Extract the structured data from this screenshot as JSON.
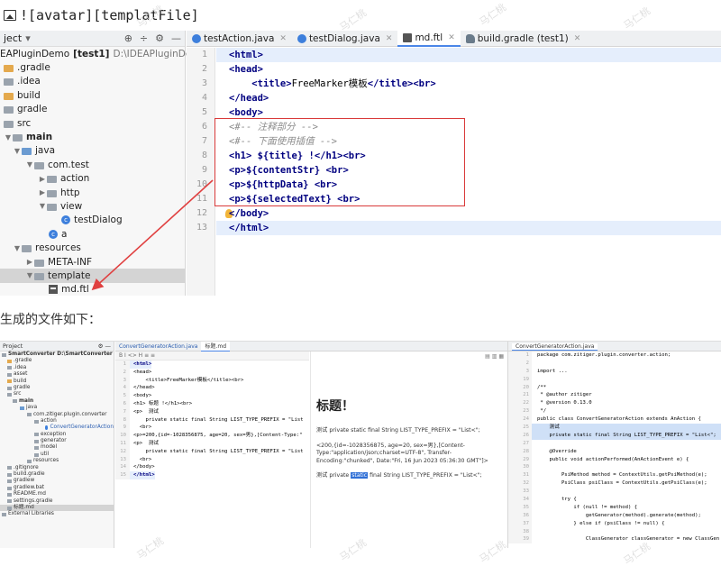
{
  "markdown_line": "![avatar][templatFile]",
  "caption": "生成的文件如下：",
  "watermark": "马仁桃",
  "ide1": {
    "project_header": {
      "title": "ject",
      "caret": "▾"
    },
    "tree": [
      {
        "label": "EAPluginDemo",
        "bold": "[test1]",
        "path": "D:\\IDEAPluginDemo"
      },
      {
        "label": ".gradle"
      },
      {
        "label": ".idea"
      },
      {
        "label": "build"
      },
      {
        "label": "gradle"
      },
      {
        "label": "src"
      },
      {
        "label": "main"
      },
      {
        "label": "java"
      },
      {
        "label": "com.test"
      },
      {
        "label": "action"
      },
      {
        "label": "http"
      },
      {
        "label": "view"
      },
      {
        "label": "testDialog"
      },
      {
        "label": "a"
      },
      {
        "label": "resources"
      },
      {
        "label": "META-INF"
      },
      {
        "label": "template"
      },
      {
        "label": "md.ftl"
      }
    ],
    "tabs": [
      {
        "label": "testAction.java"
      },
      {
        "label": "testDialog.java"
      },
      {
        "label": "md.ftl"
      },
      {
        "label": "build.gradle (test1)"
      }
    ],
    "line_numbers": [
      "1",
      "2",
      "3",
      "4",
      "5",
      "6",
      "7",
      "8",
      "9",
      "10",
      "11",
      "12",
      "13"
    ],
    "code": {
      "l1": "<html>",
      "l2": "<head>",
      "l3a": "<title>",
      "l3b": "FreeMarker模板",
      "l3c": "</title><br>",
      "l4": "</head>",
      "l5": "<body>",
      "l6": "<#-- 注释部分 -->",
      "l7": "<#-- 下面使用插值 -->",
      "l8a": "<h1> ",
      "l8b": "${title}",
      "l8c": " !</h1><br>",
      "l9a": "<p>",
      "l9b": "${contentStr}",
      "l9c": " <br>",
      "l10a": "<p>",
      "l10b": "${httpData}",
      "l10c": " <br>",
      "l11a": "<p>",
      "l11b": "${selectedText}",
      "l11c": " <br>",
      "l12": "</body>",
      "l13": "</html>"
    }
  },
  "ide2": {
    "project_title": "Project",
    "tree": [
      "SmartConverter  D:\\SmartConverter",
      ".gradle",
      ".idea",
      "asset",
      "build",
      "gradle",
      "src",
      "main",
      "java",
      "com.zitiger.plugin.converter",
      "action",
      "ConvertGeneratorAction",
      "exception",
      "generator",
      "model",
      "util",
      "resources",
      ".gitignore",
      "build.gradle",
      "gradlew",
      "gradlew.bat",
      "README.md",
      "settings.gradle",
      "标题.md",
      "External Libraries"
    ],
    "tabs": [
      "ConvertGeneratorAction.java",
      "标题.md"
    ],
    "toolbar": "B  I  <>  H  ≡  ≡",
    "code_lines": [
      "<html>",
      "<head>",
      "    <title>FreeMarker模板</title><br>",
      "</head>",
      "<body>",
      "<h1> 标题 !</h1><br>",
      "<p>  测试",
      "    private static final String LIST_TYPE_PREFIX = \"List",
      "  <br>",
      "<p>=200,{id=-1028356875, age=20, sex=男},[Content-Type:\"",
      "<p>  测试",
      "    private static final String LIST_TYPE_PREFIX = \"List",
      "  <br>",
      "</body>",
      "</html>"
    ],
    "preview": {
      "heading": "标题！",
      "p1": "测试 private static final String LIST_TYPE_PREFIX = \"List<\";",
      "p2": "<200,{id=-1028356875, age=20, sex=男},[Content-Type:\"application/json;charset=UTF-8\", Transfer-Encoding:\"chunked\", Date:\"Fri, 16 Jun 2023 05:36:30 GMT\"]>",
      "p3a": "测试 private ",
      "p3b": "static",
      "p3c": " final String LIST_TYPE_PREFIX = \"List<\";"
    },
    "right_tab": "ConvertGeneratorAction.java",
    "right_code": [
      {
        "n": "1",
        "t": "package com.zitiger.plugin.converter.action;"
      },
      {
        "n": "2",
        "t": ""
      },
      {
        "n": "3",
        "t": "import ..."
      },
      {
        "n": "19",
        "t": ""
      },
      {
        "n": "20",
        "t": "/**"
      },
      {
        "n": "21",
        "t": " * @author zitiger"
      },
      {
        "n": "22",
        "t": " * @version 0.13.0"
      },
      {
        "n": "23",
        "t": " */"
      },
      {
        "n": "24",
        "t": "public class ConvertGeneratorAction extends AnAction {"
      },
      {
        "n": "25",
        "t": "    测试"
      },
      {
        "n": "26",
        "t": "    private static final String LIST_TYPE_PREFIX = \"List<\";"
      },
      {
        "n": "27",
        "t": ""
      },
      {
        "n": "28",
        "t": "    @Override"
      },
      {
        "n": "29",
        "t": "    public void actionPerformed(AnActionEvent e) {"
      },
      {
        "n": "30",
        "t": ""
      },
      {
        "n": "31",
        "t": "        PsiMethod method = ContextUtils.getPsiMethod(e);"
      },
      {
        "n": "32",
        "t": "        PsiClass psiClass = ContextUtils.getPsiClass(e);"
      },
      {
        "n": "33",
        "t": ""
      },
      {
        "n": "34",
        "t": "        try {"
      },
      {
        "n": "35",
        "t": "            if (null != method) {"
      },
      {
        "n": "36",
        "t": "                getGenerator(method).generate(method);"
      },
      {
        "n": "37",
        "t": "            } else if (psiClass != null) {"
      },
      {
        "n": "38",
        "t": ""
      },
      {
        "n": "39",
        "t": "                ClassGenerator classGenerator = new ClassGen"
      }
    ]
  },
  "colors": {
    "highlight_box": "#d93a3a",
    "arrow": "#e04040",
    "tag": "#000080",
    "comment": "#8c8c8c",
    "selection": "#d4d4d4"
  }
}
